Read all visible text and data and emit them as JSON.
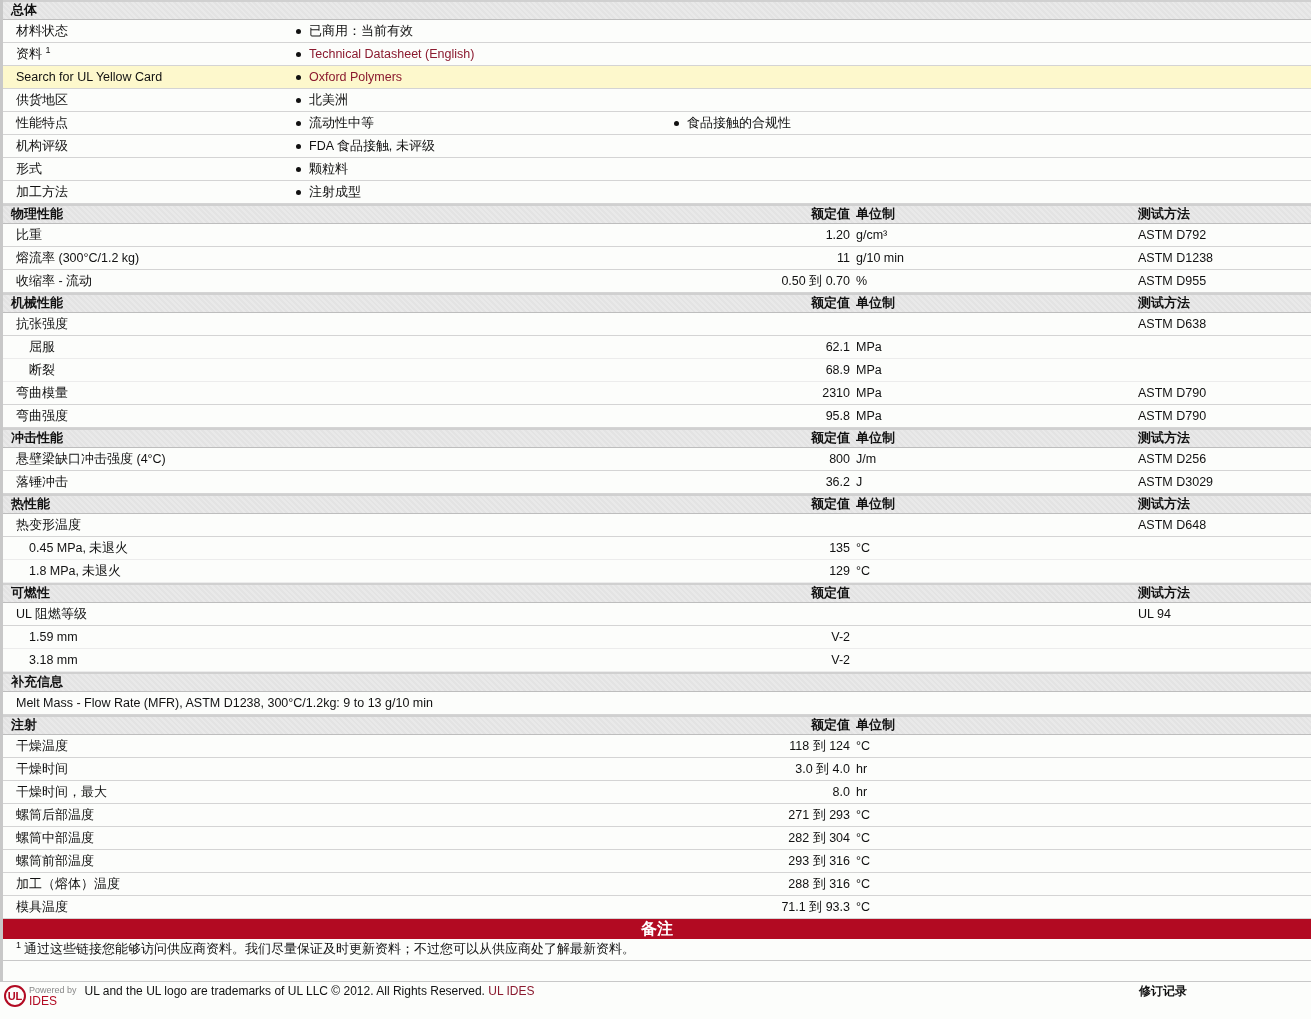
{
  "general": {
    "title": "总体",
    "rows": [
      {
        "label": "材料状态",
        "highlighted": false,
        "values": [
          {
            "text": "已商用：当前有效",
            "link": false
          }
        ]
      },
      {
        "label": "资料 $^{1}$",
        "highlighted": false,
        "values": [
          {
            "text": "Technical Datasheet (English)",
            "link": true
          }
        ]
      },
      {
        "label": "Search for UL Yellow Card",
        "highlighted": true,
        "values": [
          {
            "text": "Oxford Polymers",
            "link": true
          }
        ]
      },
      {
        "label": "供货地区",
        "highlighted": false,
        "values": [
          {
            "text": "北美洲",
            "link": false
          }
        ]
      },
      {
        "label": "性能特点",
        "highlighted": false,
        "values": [
          {
            "text": "流动性中等",
            "link": false
          },
          {
            "text": "食品接触的合规性",
            "link": false
          }
        ]
      },
      {
        "label": "机构评级",
        "highlighted": false,
        "values": [
          {
            "text": "FDA 食品接触, 未评级",
            "link": false
          }
        ]
      },
      {
        "label": "形式",
        "highlighted": false,
        "values": [
          {
            "text": "颗粒料",
            "link": false
          }
        ]
      },
      {
        "label": "加工方法",
        "highlighted": false,
        "values": [
          {
            "text": "注射成型",
            "link": false
          }
        ]
      }
    ]
  },
  "sections": [
    {
      "kind": "table",
      "title": "物理性能",
      "headers": {
        "value": "额定值",
        "unit": "单位制",
        "method": "测试方法"
      },
      "rows": [
        {
          "label": "比重",
          "value": "1.20",
          "unit": "g/cm³",
          "method": "ASTM D792"
        },
        {
          "label": "熔流率  (300°C/1.2 kg)",
          "value": "11",
          "unit": "g/10 min",
          "method": "ASTM D1238"
        },
        {
          "label": "收缩率  - 流动",
          "value": "0.50 到  0.70",
          "unit": "%",
          "method": "ASTM D955"
        }
      ]
    },
    {
      "kind": "table",
      "title": "机械性能",
      "headers": {
        "value": "额定值",
        "unit": "单位制",
        "method": "测试方法"
      },
      "rows": [
        {
          "label": "抗张强度",
          "method": "ASTM D638",
          "children": [
            {
              "label": "屈服",
              "value": "62.1",
              "unit": "MPa"
            },
            {
              "label": "断裂",
              "value": "68.9",
              "unit": "MPa"
            }
          ]
        },
        {
          "label": "弯曲模量",
          "value": "2310",
          "unit": "MPa",
          "method": "ASTM D790"
        },
        {
          "label": "弯曲强度",
          "value": "95.8",
          "unit": "MPa",
          "method": "ASTM D790"
        }
      ]
    },
    {
      "kind": "table",
      "title": "冲击性能",
      "headers": {
        "value": "额定值",
        "unit": "单位制",
        "method": "测试方法"
      },
      "rows": [
        {
          "label": "悬壁梁缺口冲击强度  (4°C)",
          "value": "800",
          "unit": "J/m",
          "method": "ASTM D256"
        },
        {
          "label": "落锤冲击",
          "value": "36.2",
          "unit": "J",
          "method": "ASTM D3029"
        }
      ]
    },
    {
      "kind": "table",
      "title": "热性能",
      "headers": {
        "value": "额定值",
        "unit": "单位制",
        "method": "测试方法"
      },
      "rows": [
        {
          "label": "热变形温度",
          "method": "ASTM D648",
          "children": [
            {
              "label": "0.45 MPa, 未退火",
              "value": "135",
              "unit": "°C"
            },
            {
              "label": "1.8 MPa, 未退火",
              "value": "129",
              "unit": "°C"
            }
          ]
        }
      ]
    },
    {
      "kind": "table",
      "title": "可燃性",
      "headers": {
        "value": "额定值",
        "method": "测试方法"
      },
      "rows": [
        {
          "label": "UL 阻燃等级",
          "method": "UL 94",
          "children": [
            {
              "label": "1.59 mm",
              "value": "V-2"
            },
            {
              "label": "3.18 mm",
              "value": "V-2"
            }
          ]
        }
      ]
    },
    {
      "kind": "text",
      "title": "补充信息",
      "text": "Melt Mass - Flow Rate (MFR), ASTM D1238, 300°C/1.2kg: 9 to 13 g/10 min"
    },
    {
      "kind": "table",
      "title": "注射",
      "headers": {
        "value": "额定值",
        "unit": "单位制"
      },
      "rows": [
        {
          "label": "干燥温度",
          "value": "118 到  124",
          "unit": "°C"
        },
        {
          "label": "干燥时间",
          "value": "3.0 到  4.0",
          "unit": "hr"
        },
        {
          "label": "干燥时间，最大",
          "value": "8.0",
          "unit": "hr"
        },
        {
          "label": "螺筒后部温度",
          "value": "271 到  293",
          "unit": "°C"
        },
        {
          "label": "螺筒中部温度",
          "value": "282 到  304",
          "unit": "°C"
        },
        {
          "label": "螺筒前部温度",
          "value": "293 到  316",
          "unit": "°C"
        },
        {
          "label": "加工（熔体）温度",
          "value": "288 到  316",
          "unit": "°C"
        },
        {
          "label": "模具温度",
          "value": "71.1 到  93.3",
          "unit": "°C"
        }
      ]
    }
  ],
  "notes": {
    "title": "备注",
    "footnote": "$^{1}$ 通过这些链接您能够访问供应商资料。我们尽量保证及时更新资料；不过您可以从供应商处了解最新资料。"
  },
  "footer": {
    "logo_mark": "UL",
    "logo_caption": "Powered by",
    "logo_name": "IDES",
    "notice": "UL and the UL logo are trademarks of UL LLC © 2012. All Rights Reserved.",
    "notice_link": "UL IDES",
    "revision_title": "修订记录"
  }
}
